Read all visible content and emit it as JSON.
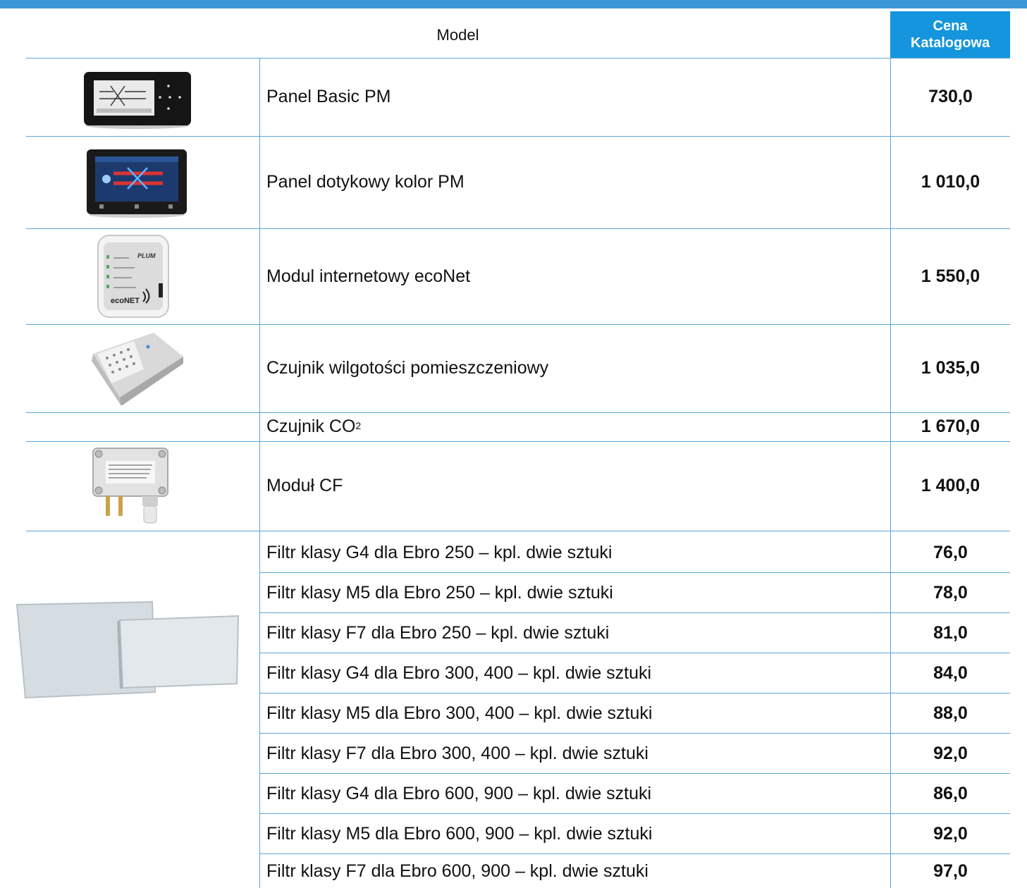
{
  "banner": {
    "title": ""
  },
  "table": {
    "header_model": "Model",
    "header_price_line1": "Cena",
    "header_price_line2": "Katalogowa",
    "rows": [
      {
        "name": "Panel Basic PM",
        "price": "730,0"
      },
      {
        "name": "Panel dotykowy kolor PM",
        "price": "1 010,0"
      },
      {
        "name": "Modul internetowy ecoNet",
        "price": "1 550,0"
      },
      {
        "name": "Czujnik wilgotości pomieszczeniowy",
        "price": "1 035,0"
      },
      {
        "name": "Czujnik CO",
        "name_sup": "2",
        "price": "1 670,0"
      },
      {
        "name": "Moduł CF",
        "price": "1 400,0"
      }
    ],
    "filters": [
      {
        "name": "Filtr klasy G4 dla Ebro 250 – kpl. dwie sztuki",
        "price": "76,0"
      },
      {
        "name": "Filtr klasy M5 dla Ebro 250 – kpl. dwie sztuki",
        "price": "78,0"
      },
      {
        "name": "Filtr klasy F7 dla Ebro 250 – kpl. dwie sztuki",
        "price": "81,0"
      },
      {
        "name": "Filtr klasy G4 dla Ebro 300, 400 – kpl. dwie sztuki",
        "price": "84,0"
      },
      {
        "name": "Filtr klasy M5 dla Ebro 300, 400 – kpl. dwie sztuki",
        "price": "88,0"
      },
      {
        "name": "Filtr klasy F7 dla Ebro 300, 400 – kpl. dwie sztuki",
        "price": "92,0"
      },
      {
        "name": "Filtr klasy G4 dla Ebro 600, 900 – kpl. dwie sztuki",
        "price": "86,0"
      },
      {
        "name": "Filtr klasy M5 dla Ebro 600, 900 – kpl. dwie sztuki",
        "price": "92,0"
      },
      {
        "name": "Filtr klasy F7 dla Ebro 600, 900 – kpl. dwie sztuki",
        "price": "97,0"
      }
    ]
  },
  "images": {
    "row0": "basic-panel-image",
    "row1": "touch-panel-image",
    "row2": "econet-module-image",
    "row3": "humidity-sensor-image",
    "row5": "cf-module-image",
    "filters": "filter-pads-image"
  },
  "colors": {
    "accent": "#1495dd",
    "banner": "#3a96d6",
    "rule": "#5aa6d8"
  }
}
